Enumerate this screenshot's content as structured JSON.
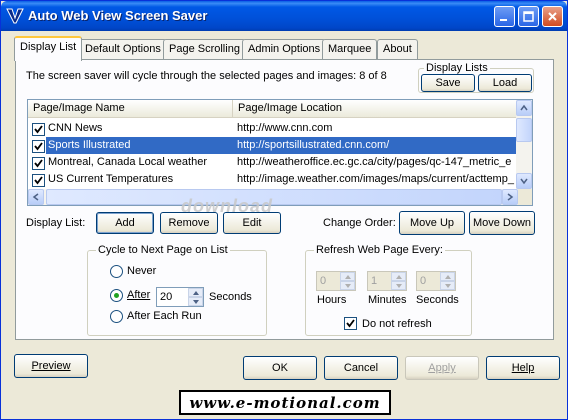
{
  "window": {
    "title": "Auto Web View Screen Saver",
    "icon": "app-v-icon",
    "controls": [
      "minimize-icon",
      "maximize-icon",
      "close-icon"
    ]
  },
  "tabs": [
    {
      "label": "Display List",
      "active": true
    },
    {
      "label": "Default Options"
    },
    {
      "label": "Page Scrolling"
    },
    {
      "label": "Admin Options"
    },
    {
      "label": "Marquee"
    },
    {
      "label": "About"
    }
  ],
  "display_list": {
    "cycle_text": "The screen saver will cycle through the selected pages and images:",
    "count_text": "8 of 8",
    "lists_group": {
      "title": "Display Lists",
      "save_label": "Save",
      "load_label": "Load"
    },
    "columns": [
      "Page/Image Name",
      "Page/Image Location"
    ],
    "rows": [
      {
        "checked": true,
        "name": "CNN News",
        "location": "http://www.cnn.com",
        "selected": false
      },
      {
        "checked": true,
        "name": "Sports Illustrated",
        "location": "http://sportsillustrated.cnn.com/",
        "selected": true
      },
      {
        "checked": true,
        "name": "Montreal, Canada Local weather",
        "location": "http://weatheroffice.ec.gc.ca/city/pages/qc-147_metric_e",
        "selected": false
      },
      {
        "checked": true,
        "name": "US Current Temperatures",
        "location": "http://image.weather.com/images/maps/current/acttemp_",
        "selected": false
      }
    ],
    "display_list_label": "Display List:",
    "add_label": "Add",
    "remove_label": "Remove",
    "edit_label": "Edit",
    "change_order_label": "Change Order:",
    "move_up_label": "Move Up",
    "move_down_label": "Move Down"
  },
  "cycle_group": {
    "title": "Cycle to Next Page on List",
    "never_label": "Never",
    "after_label": "After",
    "after_value": "20",
    "seconds_label": "Seconds",
    "after_each_run_label": "After Each Run",
    "selected": "after"
  },
  "refresh_group": {
    "title": "Refresh Web Page Every:",
    "hours_value": "0",
    "minutes_value": "1",
    "seconds_value": "0",
    "hours_label": "Hours",
    "minutes_label": "Minutes",
    "seconds_label": "Seconds",
    "no_refresh_label": "Do not refresh",
    "no_refresh_checked": true
  },
  "watermark": "download",
  "buttons": {
    "preview": "Preview",
    "ok": "OK",
    "cancel": "Cancel",
    "apply": "Apply",
    "help": "Help"
  },
  "banner": "www.e-motional.com",
  "colors": {
    "title_bar": "#0054e3",
    "selection": "#316ac5",
    "tab_highlight": "#ffc73c"
  }
}
